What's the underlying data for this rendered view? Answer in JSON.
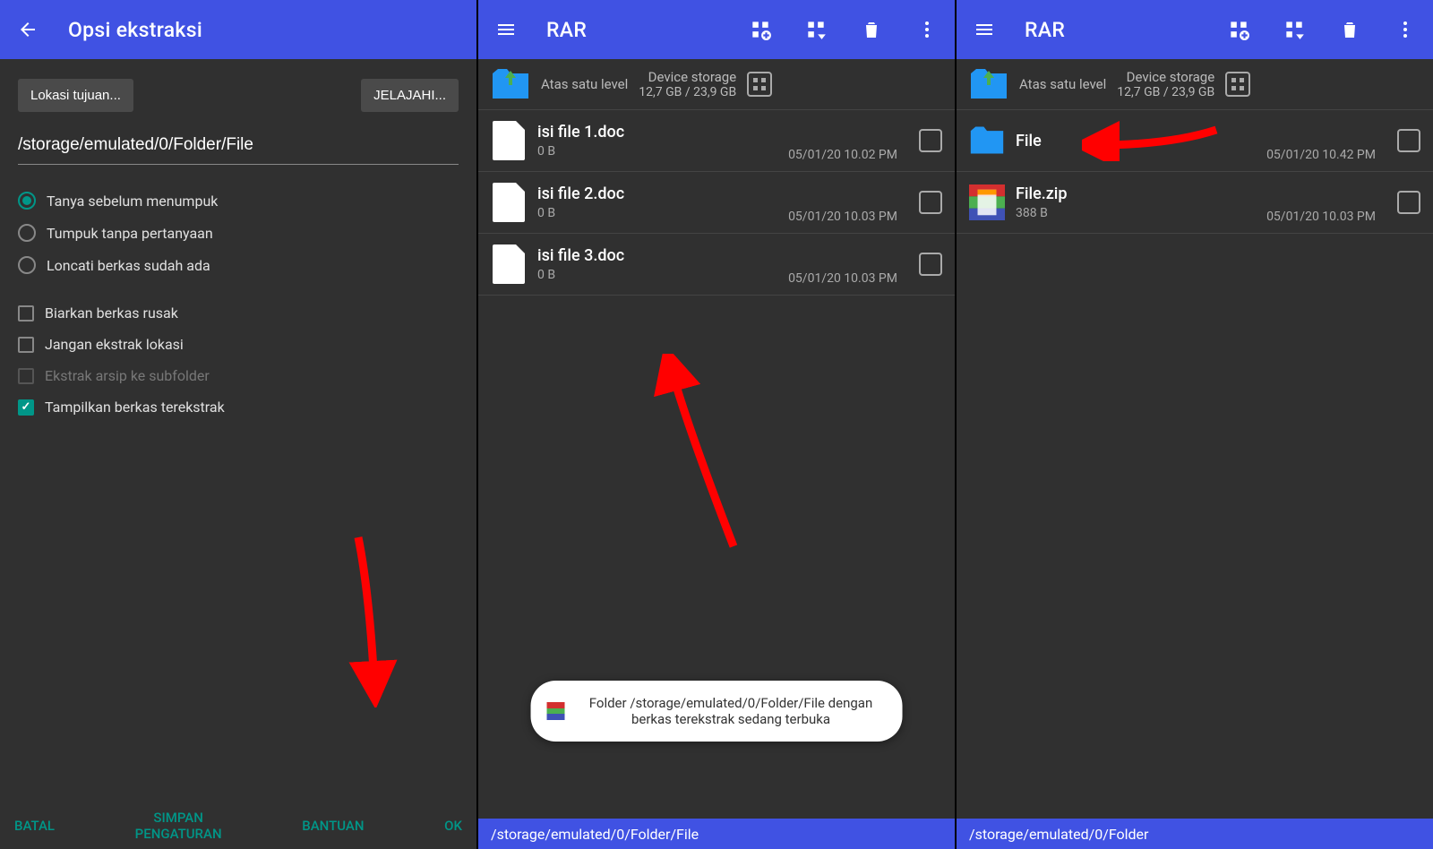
{
  "panel1": {
    "title": "Opsi ekstraksi",
    "btn_location": "Lokasi tujuan...",
    "btn_browse": "JELAJAHI...",
    "path": "/storage/emulated/0/Folder/File",
    "radios": [
      {
        "label": "Tanya sebelum menumpuk",
        "selected": true
      },
      {
        "label": "Tumpuk tanpa pertanyaan",
        "selected": false
      },
      {
        "label": "Loncati berkas sudah ada",
        "selected": false
      }
    ],
    "checks": [
      {
        "label": "Biarkan berkas rusak",
        "checked": false,
        "disabled": false
      },
      {
        "label": "Jangan ekstrak lokasi",
        "checked": false,
        "disabled": false
      },
      {
        "label": "Ekstrak arsip ke subfolder",
        "checked": false,
        "disabled": true
      },
      {
        "label": "Tampilkan berkas terekstrak",
        "checked": true,
        "disabled": false
      }
    ],
    "footer": {
      "cancel": "BATAL",
      "save": "SIMPAN PENGATURAN",
      "help": "BANTUAN",
      "ok": "OK"
    }
  },
  "panel2": {
    "title": "RAR",
    "up_label": "Atas satu level",
    "storage_label": "Device storage",
    "storage_info": "12,7 GB / 23,9 GB",
    "files": [
      {
        "name": "isi file 1.doc",
        "size": "0 B",
        "date": "05/01/20 10.02 PM",
        "type": "doc"
      },
      {
        "name": "isi file 2.doc",
        "size": "0 B",
        "date": "05/01/20 10.03 PM",
        "type": "doc"
      },
      {
        "name": "isi file 3.doc",
        "size": "0 B",
        "date": "05/01/20 10.03 PM",
        "type": "doc"
      }
    ],
    "toast": "Folder /storage/emulated/0/Folder/File dengan berkas terekstrak sedang terbuka",
    "path_footer": "/storage/emulated/0/Folder/File"
  },
  "panel3": {
    "title": "RAR",
    "up_label": "Atas satu level",
    "storage_label": "Device storage",
    "storage_info": "12,7 GB / 23,9 GB",
    "files": [
      {
        "name": "File",
        "size": "",
        "date": "05/01/20 10.42 PM",
        "type": "folder"
      },
      {
        "name": "File.zip",
        "size": "388 B",
        "date": "05/01/20 10.03 PM",
        "type": "zip"
      }
    ],
    "path_footer": "/storage/emulated/0/Folder"
  }
}
